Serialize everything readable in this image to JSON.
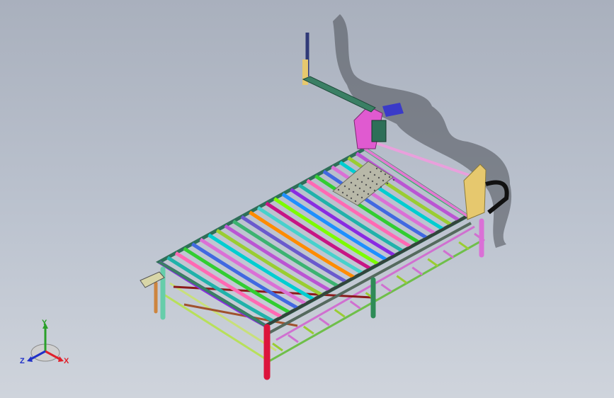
{
  "viewport": {
    "background_top": "#a9b0bd",
    "background_bottom": "#cfd4dc"
  },
  "model": {
    "description_icon": "cnc-plasma-cutting-table-3d-model",
    "frame_color": "#2e6f58",
    "slat_colors": [
      "#8a2be2",
      "#20b2aa",
      "#ff69b4",
      "#32cd32",
      "#4169e1",
      "#da70d6",
      "#00ced1",
      "#9acd32",
      "#ba55d3",
      "#3cb371",
      "#6a5acd",
      "#ff8c00",
      "#48d1cc",
      "#c71585",
      "#7cfc00",
      "#1e90ff"
    ],
    "leg_colors": [
      "#dc143c",
      "#66cdaa",
      "#2e8b57",
      "#da70d6",
      "#cd853f"
    ],
    "gantry_color": "#e6c86e"
  },
  "triad": {
    "x_label": "X",
    "y_label": "Y",
    "z_label": "Z",
    "x_color": "#e0202a",
    "y_color": "#2aa02a",
    "z_color": "#2030c8"
  }
}
